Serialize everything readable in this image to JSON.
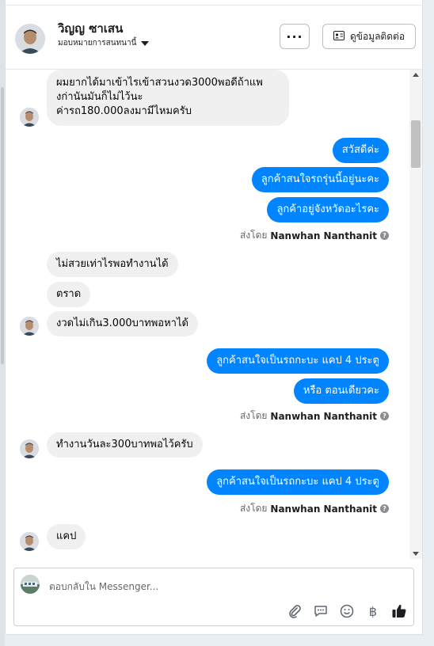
{
  "header": {
    "contact_name": "วิญญ ซาเสน",
    "assign_label": "มอบหมายการสนทนานี้",
    "more_label": "···",
    "view_contact_label": "ดูข้อมูลติดต่อ"
  },
  "messages": {
    "m1": "ผมยากได้มาเข้าไรเข้าสวนงวด3000พอดีถ้าแพ\nงก่านันมันก็ไม่ไว้นะ\nค่ารถ180.000ลงมามีไหมครับ",
    "m2": "สวัสดีค่ะ",
    "m3": "ลูกค้าสนใจรถรุ่นนี้อยู่นะคะ",
    "m4": "ลูกค้าอยู่จังหวัดอะไรคะ",
    "m5": "ไม่สวยเท่าไรพอทำงานได้",
    "m6": "ตราด",
    "m7": "งวดไม่เกิน3.000บาทพอหาได้",
    "m8": "ลูกค้าสนใจเป็นรถกะบะ แคป 4 ประตู",
    "m9": "หรือ ตอนเดียวคะ",
    "m10": "ทำงานวันละ300บาทพอไว้ครับ",
    "m11": "ลูกค้าสนใจเป็นรถกะบะ แคป 4 ประตู",
    "m12": "แคป"
  },
  "sent_by": {
    "prefix": "ส่งโดย",
    "name": "Nanwhan Nanthanit"
  },
  "composer": {
    "placeholder": "ตอบกลับใน Messenger...",
    "currency_symbol": "฿"
  },
  "colors": {
    "outgoing_bubble": "#0084ff",
    "incoming_bubble": "#f0f0f0"
  },
  "icons": [
    "chevron-down-icon",
    "contact-card-icon",
    "help-icon",
    "attach-icon",
    "saved-reply-icon",
    "emoji-icon",
    "baht-icon",
    "thumbs-up-icon"
  ]
}
